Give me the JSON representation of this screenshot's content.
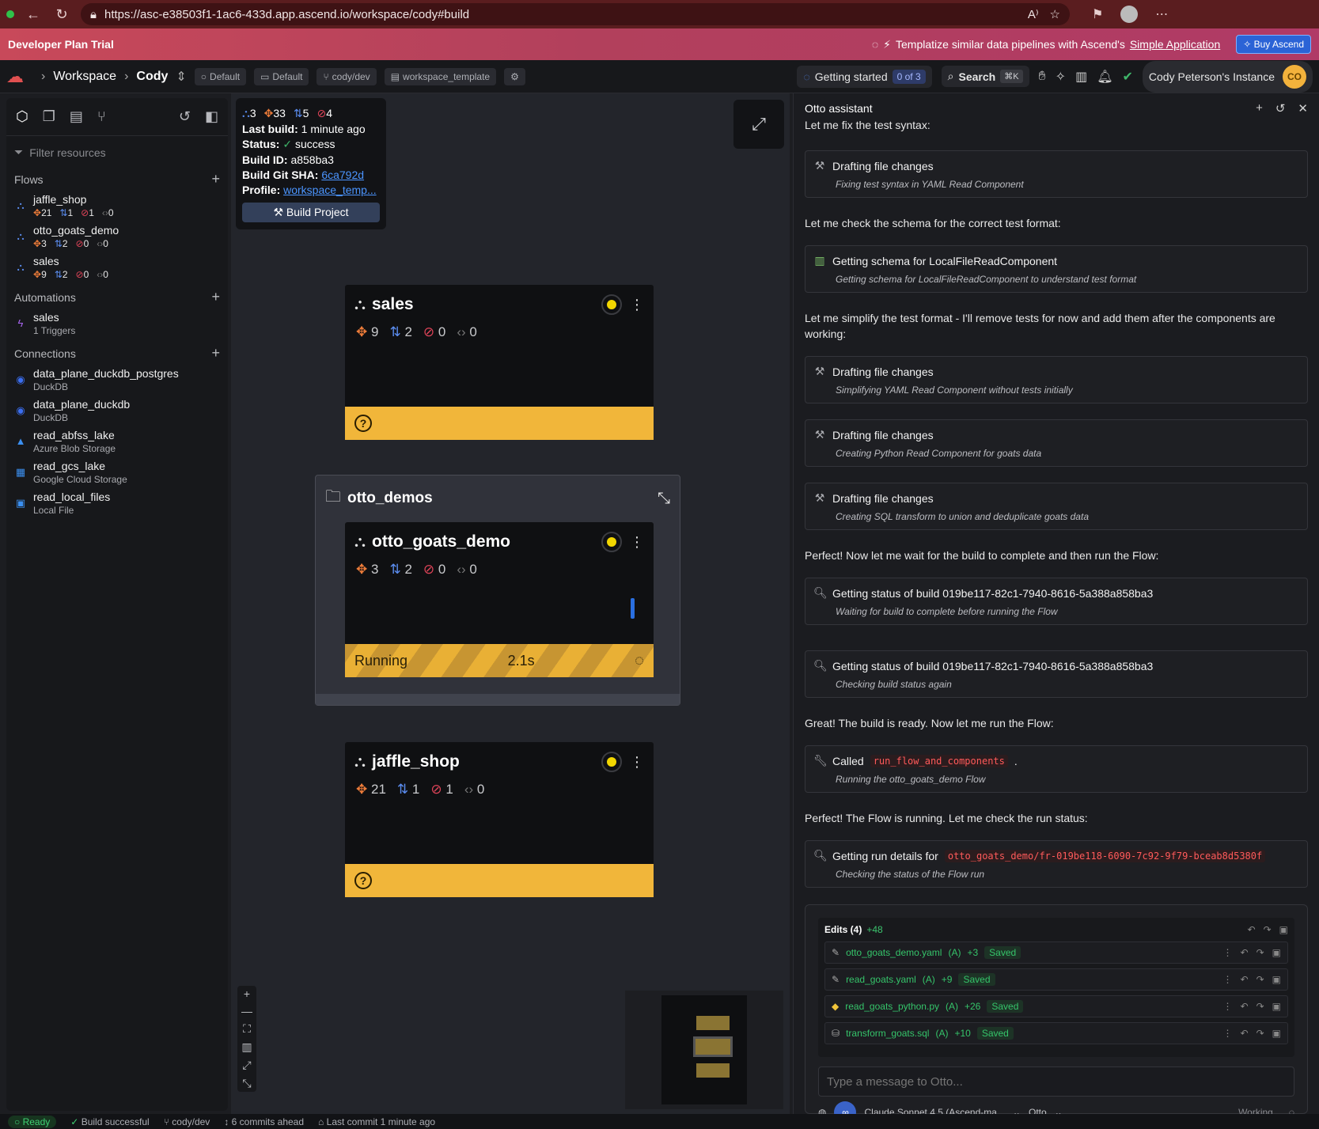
{
  "browser": {
    "url": "https://asc-e38503f1-1ac6-433d.app.ascend.io/workspace/cody#build"
  },
  "trial": {
    "title": "Developer Plan Trial",
    "promo_text": "Templatize similar data pipelines with Ascend's",
    "promo_link": "Simple Application",
    "buy_label": "Buy Ascend"
  },
  "header": {
    "crumb_workspace": "Workspace",
    "crumb_cody": "Cody",
    "chips": [
      "Default",
      "Default",
      "cody/dev",
      "workspace_template"
    ],
    "getting_started": "Getting started",
    "getting_started_count": "0 of 3",
    "search_label": "Search",
    "search_kbd": "⌘K",
    "instance_name": "Cody Peterson's Instance",
    "avatar_initials": "CO"
  },
  "sidebar": {
    "filter_placeholder": "Filter resources",
    "flows_label": "Flows",
    "flows": [
      {
        "name": "jaffle_shop",
        "c1": "21",
        "c2": "1",
        "c3": "1",
        "c4": "0"
      },
      {
        "name": "otto_goats_demo",
        "c1": "3",
        "c2": "2",
        "c3": "0",
        "c4": "0"
      },
      {
        "name": "sales",
        "c1": "9",
        "c2": "2",
        "c3": "0",
        "c4": "0"
      }
    ],
    "automations_label": "Automations",
    "automations": [
      {
        "name": "sales",
        "sub": "1 Triggers"
      }
    ],
    "connections_label": "Connections",
    "connections": [
      {
        "name": "data_plane_duckdb_postgres",
        "sub": "DuckDB",
        "color": "#3b6ef0"
      },
      {
        "name": "data_plane_duckdb",
        "sub": "DuckDB",
        "color": "#3b6ef0"
      },
      {
        "name": "read_abfss_lake",
        "sub": "Azure Blob Storage",
        "color": "#3b8ff0"
      },
      {
        "name": "read_gcs_lake",
        "sub": "Google Cloud Storage",
        "color": "#3b8ff0"
      },
      {
        "name": "read_local_files",
        "sub": "Local File",
        "color": "#3b8ff0"
      }
    ]
  },
  "build": {
    "c1": "3",
    "c2": "33",
    "c3": "5",
    "c4": "4",
    "last_build_label": "Last build:",
    "last_build": "1 minute ago",
    "status_label": "Status:",
    "status": "success",
    "build_id_label": "Build ID:",
    "build_id": "a858ba3",
    "sha_label": "Build Git SHA:",
    "sha": "6ca792d",
    "profile_label": "Profile:",
    "profile": "workspace_temp...",
    "button": "Build Project"
  },
  "canvas": {
    "group_title": "otto_demos",
    "sales": {
      "title": "sales",
      "m1": "9",
      "m2": "2",
      "m3": "0",
      "m4": "0"
    },
    "otto_goats_demo": {
      "title": "otto_goats_demo",
      "m1": "3",
      "m2": "2",
      "m3": "0",
      "m4": "0",
      "running_label": "Running",
      "running_time": "2.1s"
    },
    "jaffle_shop": {
      "title": "jaffle_shop",
      "m1": "21",
      "m2": "1",
      "m3": "1",
      "m4": "0"
    }
  },
  "otto": {
    "title": "Otto assistant",
    "m1": "Let me fix the test syntax:",
    "t1": {
      "title": "Drafting file changes",
      "sub": "Fixing test syntax in YAML Read Component"
    },
    "m2": "Let me check the schema for the correct test format:",
    "t2": {
      "title": "Getting schema for LocalFileReadComponent",
      "sub": "Getting schema for LocalFileReadComponent to understand test format"
    },
    "m3": "Let me simplify the test format - I'll remove tests for now and add them after the components are working:",
    "t3": {
      "title": "Drafting file changes",
      "sub": "Simplifying YAML Read Component without tests initially"
    },
    "t4": {
      "title": "Drafting file changes",
      "sub": "Creating Python Read Component for goats data"
    },
    "t5": {
      "title": "Drafting file changes",
      "sub": "Creating SQL transform to union and deduplicate goats data"
    },
    "m4": "Perfect! Now let me wait for the build to complete and then run the Flow:",
    "t6": {
      "title": "Getting status of build 019be117-82c1-7940-8616-5a388a858ba3",
      "sub": "Waiting for build to complete before running the Flow"
    },
    "t7": {
      "title": "Getting status of build 019be117-82c1-7940-8616-5a388a858ba3",
      "sub": "Checking build status again"
    },
    "m5": "Great! The build is ready. Now let me run the Flow:",
    "t8": {
      "title_pre": "Called",
      "code": "run_flow_and_components",
      "sub": "Running the otto_goats_demo Flow"
    },
    "m6": "Perfect! The Flow is running. Let me check the run status:",
    "t9": {
      "title_pre": "Getting run details for",
      "code": "otto_goats_demo/fr-019be118-6090-7c92-9f79-bceab8d5380f",
      "sub": "Checking the status of the Flow run"
    },
    "edits_label": "Edits (4)",
    "edits_plus": "+48",
    "edits": [
      {
        "file": "otto_goats_demo.yaml",
        "tag": "(A)",
        "diff": "+3",
        "state": "Saved"
      },
      {
        "file": "read_goats.yaml",
        "tag": "(A)",
        "diff": "+9",
        "state": "Saved"
      },
      {
        "file": "read_goats_python.py",
        "tag": "(A)",
        "diff": "+26",
        "state": "Saved"
      },
      {
        "file": "transform_goats.sql",
        "tag": "(A)",
        "diff": "+10",
        "state": "Saved"
      }
    ],
    "input_placeholder": "Type a message to Otto...",
    "model": "Claude Sonnet 4.5 (Ascend-ma...",
    "agent": "Otto",
    "working": "Working..."
  },
  "status": {
    "ready": "Ready",
    "build": "Build successful",
    "branch": "cody/dev",
    "ahead": "6 commits ahead",
    "last_commit": "Last commit 1 minute ago"
  }
}
